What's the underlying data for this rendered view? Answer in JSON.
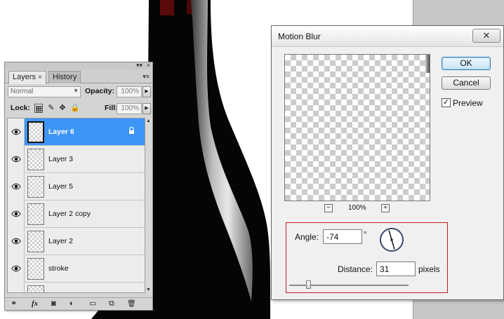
{
  "layers_panel": {
    "tabs": [
      {
        "label": "Layers",
        "close": "×"
      },
      {
        "label": "History"
      }
    ],
    "titlebar_buttons": {
      "minimize": "▾▾",
      "close": "×"
    },
    "menu_icon": "▾≡",
    "blend_mode": "Normal",
    "opacity_label": "Opacity:",
    "opacity_value": "100%",
    "lock_label": "Lock:",
    "fill_label": "Fill:",
    "fill_value": "100%",
    "spin_arrow": "▶",
    "layers": [
      {
        "name": "Layer 6",
        "selected": true,
        "locked": true
      },
      {
        "name": "Layer 3"
      },
      {
        "name": "Layer 5"
      },
      {
        "name": "Layer 2 copy"
      },
      {
        "name": "Layer 2"
      },
      {
        "name": "stroke"
      }
    ],
    "bottom_icons": [
      "link-icon",
      "fx-icon",
      "mask-icon",
      "adjustment-icon",
      "folder-icon",
      "new-layer-icon",
      "trash-icon"
    ],
    "bottom_glyphs": {
      "link": "⚭",
      "fx": "fx",
      "mask": "◙",
      "adjustment": "◐",
      "folder": "▭",
      "new_layer": "⧉",
      "trash": "🗑"
    },
    "scroll_up": "▲",
    "scroll_down": "▼"
  },
  "dialog": {
    "title": "Motion Blur",
    "close_glyph": "✕",
    "ok_label": "OK",
    "cancel_label": "Cancel",
    "preview_label": "Preview",
    "preview_checked": "✓",
    "zoom_out": "−",
    "zoom_in": "+",
    "zoom_level": "100%",
    "angle_label": "Angle:",
    "angle_value": "-74",
    "degree_symbol": "°",
    "distance_label": "Distance:",
    "distance_value": "31",
    "distance_unit": "pixels",
    "highlight_color": "#c41f1f"
  },
  "colors": {
    "selection": "#3d95f5",
    "canvas_right": "#c8c8c8"
  }
}
